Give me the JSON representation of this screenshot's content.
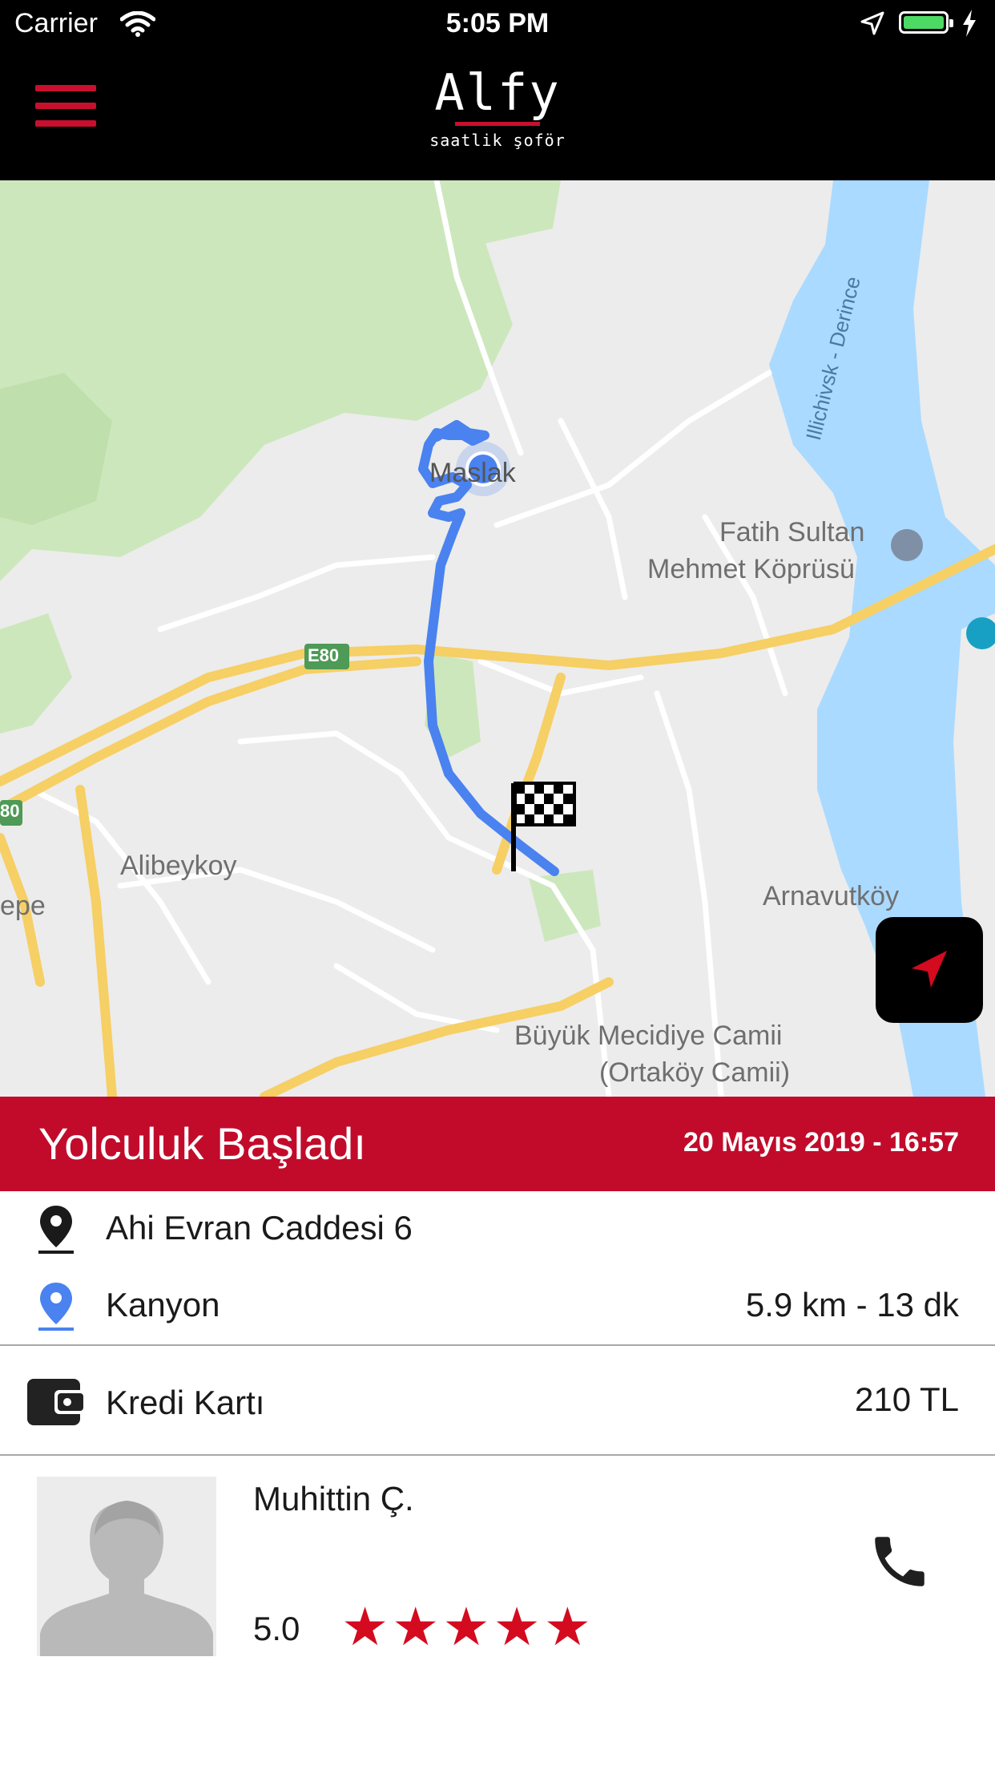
{
  "status_bar": {
    "carrier": "Carrier",
    "time": "5:05 PM",
    "battery_color": "#4cd964"
  },
  "header": {
    "menu_icon": "hamburger-menu-icon",
    "logo_name": "Alfy",
    "logo_tagline": "saatlik şoför",
    "brand_color": "#c8102e"
  },
  "map": {
    "labels": {
      "maslak": "Maslak",
      "fatih_sultan_1": "Fatih Sultan",
      "fatih_sultan_2": "Mehmet Köprüsü",
      "e80": "E80",
      "e80_left": "80",
      "alibeykoy": "Alibeykoy",
      "epe": "epe",
      "arnavutkoy": "Arnavutköy",
      "mecidiye_1": "Büyük Mecidiye Camii",
      "mecidiye_2": "(Ortaköy Camii)",
      "waterway": "Illichivsk - Derince"
    },
    "route_color": "#4a82f0",
    "recenter_icon": "navigation-arrow-icon"
  },
  "trip": {
    "status_title": "Yolculuk Başladı",
    "datetime": "20 Mayıs 2019 - 16:57",
    "pickup": "Ahi Evran Caddesi 6",
    "destination": "Kanyon",
    "distance_duration": "5.9 km - 13 dk",
    "payment_method": "Kredi Kartı",
    "price": "210 TL"
  },
  "driver": {
    "name": "Muhittin Ç.",
    "rating": "5.0",
    "stars": 5,
    "star_color": "#d40a1f"
  }
}
